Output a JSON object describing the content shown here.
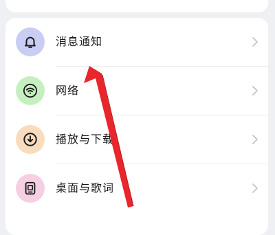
{
  "settings": {
    "items": [
      {
        "label": "消息通知",
        "icon": "bell-icon",
        "icon_bg": "#c9cdf4",
        "icon_color": "#1c1c1c"
      },
      {
        "label": "网络",
        "icon": "wifi-icon",
        "icon_bg": "#c6efc0",
        "icon_color": "#1c1c1c"
      },
      {
        "label": "播放与下载",
        "icon": "download-icon",
        "icon_bg": "#f8dcbd",
        "icon_color": "#1c1c1c"
      },
      {
        "label": "桌面与歌词",
        "icon": "lyrics-icon",
        "icon_bg": "#f6cfe3",
        "icon_color": "#1c1c1c"
      }
    ]
  },
  "annotation": {
    "arrow_color": "#e8262b"
  }
}
